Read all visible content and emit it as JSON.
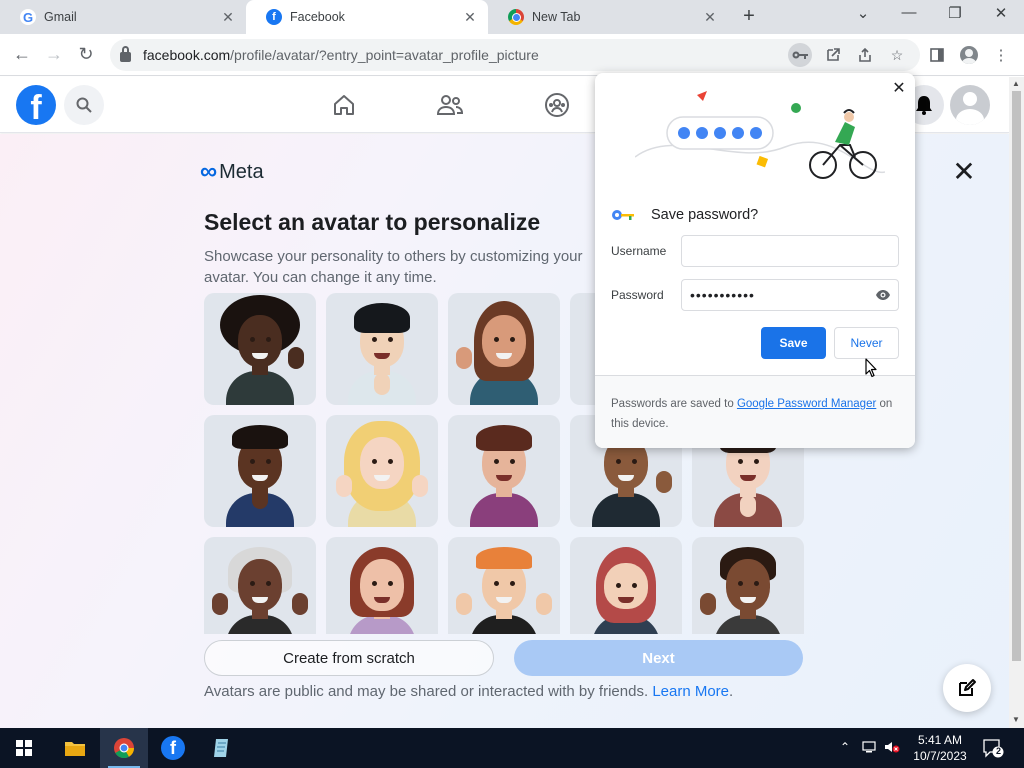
{
  "browser": {
    "tabs": [
      {
        "title": "Gmail",
        "icon": "gmail-favicon",
        "active": false
      },
      {
        "title": "Facebook",
        "icon": "facebook-favicon",
        "active": true
      },
      {
        "title": "New Tab",
        "icon": "chrome-favicon",
        "active": false
      }
    ],
    "url_host": "facebook.com",
    "url_path": "/profile/avatar/?entry_point=avatar_profile_picture"
  },
  "page": {
    "logo_text": "Meta",
    "heading": "Select an avatar to personalize",
    "subtext": "Showcase your personality to others by customizing your avatar. You can change it any time.",
    "create_button": "Create from scratch",
    "next_button": "Next",
    "footnote": "Avatars are public and may be shared or interacted with by friends.",
    "footnote_link": "Learn More",
    "footnote_end": "."
  },
  "password_popup": {
    "title": "Save password?",
    "username_label": "Username",
    "username_value": "",
    "password_label": "Password",
    "password_value": "•••••••••••",
    "save_button": "Save",
    "never_button": "Never",
    "footer_prefix": "Passwords are saved to",
    "footer_link": "Google Password Manager",
    "footer_suffix": "on this device."
  },
  "taskbar": {
    "time": "5:41 AM",
    "date": "10/7/2023",
    "notification_count": "2"
  },
  "colors": {
    "facebook_blue": "#1877f2",
    "chrome_blue": "#1a73e8",
    "next_disabled": "#a9c9f5"
  }
}
